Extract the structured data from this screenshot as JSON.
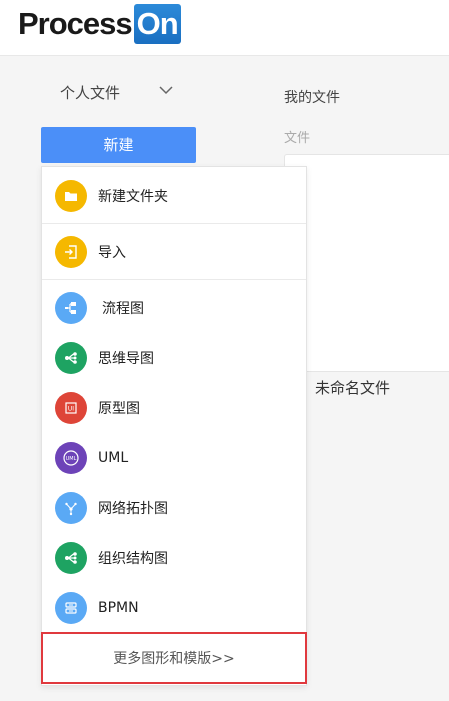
{
  "logo": {
    "text_left": "Process",
    "text_right": "On"
  },
  "sidebar": {
    "personal_label": "个人文件",
    "new_button": "新建"
  },
  "main": {
    "breadcrumb": "我的文件",
    "section_label": "文件",
    "file_name": "未命名文件"
  },
  "menu": {
    "items": [
      {
        "label": "新建文件夹",
        "icon": "folder-icon",
        "color": "#f5b800"
      },
      {
        "label": "导入",
        "icon": "import-icon",
        "color": "#f5b800"
      },
      {
        "label": "流程图",
        "icon": "flowchart-icon",
        "color": "#5aa9f5"
      },
      {
        "label": "思维导图",
        "icon": "mindmap-icon",
        "color": "#1ea362"
      },
      {
        "label": "原型图",
        "icon": "prototype-ui-icon",
        "color": "#de4538"
      },
      {
        "label": "UML",
        "icon": "uml-icon",
        "color": "#6d43b8"
      },
      {
        "label": "网络拓扑图",
        "icon": "network-topology-icon",
        "color": "#5aa9f5"
      },
      {
        "label": "组织结构图",
        "icon": "org-chart-icon",
        "color": "#1ea362"
      },
      {
        "label": "BPMN",
        "icon": "bpmn-icon",
        "color": "#5aa9f5"
      }
    ],
    "more_label": "更多图形和模版>>"
  },
  "colors": {
    "accent": "#4b8ff8",
    "highlight": "#e0393e"
  }
}
